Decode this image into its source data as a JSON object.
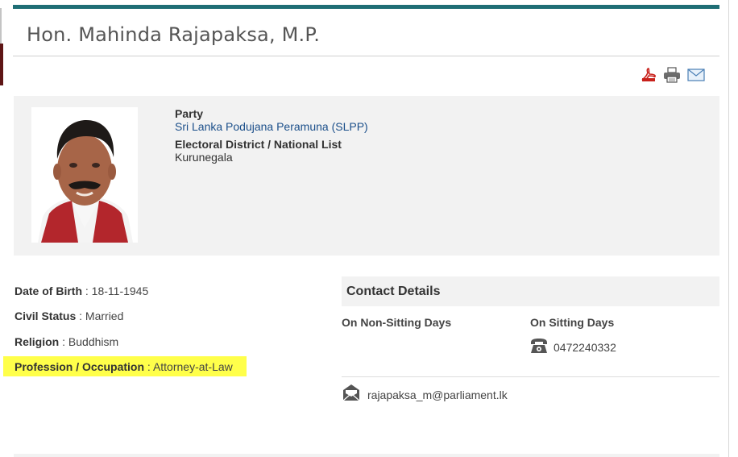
{
  "header": {
    "title": "Hon. Mahinda Rajapaksa, M.P."
  },
  "toolbar": {
    "icons": [
      "pdf-icon",
      "print-icon",
      "email-icon"
    ]
  },
  "profile": {
    "party_label": "Party",
    "party_value": "Sri Lanka Podujana Peramuna (SLPP)",
    "district_label": "Electoral District / National List",
    "district_value": "Kurunegala"
  },
  "details": {
    "dob_label": "Date of Birth",
    "dob_value": "18-11-1945",
    "civil_label": "Civil Status",
    "civil_value": "Married",
    "religion_label": "Religion",
    "religion_value": "Buddhism",
    "profession_label": "Profession / Occupation",
    "profession_value": "Attorney-at-Law",
    "separator": ":"
  },
  "contact": {
    "heading": "Contact Details",
    "non_sitting_label": "On Non-Sitting Days",
    "sitting_label": "On Sitting Days",
    "phone": "0472240332",
    "email": "rajapaksa_m@parliament.lk"
  },
  "colors": {
    "accent_bar": "#1f6e75",
    "link": "#1b4f8a",
    "highlight": "#ffff4a",
    "panel": "#f2f2f2"
  }
}
